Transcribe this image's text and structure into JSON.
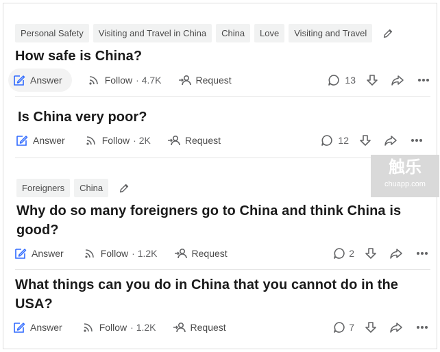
{
  "questions": [
    {
      "topics": [
        "Personal Safety",
        "Visiting and Travel in China",
        "China",
        "Love",
        "Visiting and Travel"
      ],
      "title": "How safe is China?",
      "answer_label": "Answer",
      "follow_label": "Follow",
      "follow_count": "· 4.7K",
      "request_label": "Request",
      "comment_count": "13"
    },
    {
      "topics": [],
      "title": "Is China very poor?",
      "answer_label": "Answer",
      "follow_label": "Follow",
      "follow_count": "· 2K",
      "request_label": "Request",
      "comment_count": "12"
    },
    {
      "topics": [
        "Foreigners",
        "China"
      ],
      "title_line1": "Why do so many foreigners go to China and think China is",
      "title_line2": "good?",
      "answer_label": "Answer",
      "follow_label": "Follow",
      "follow_count": "· 1.2K",
      "request_label": "Request",
      "comment_count": "2"
    },
    {
      "topics": [],
      "title_line1": "What things can you do in China that you cannot do in the",
      "title_line2": "USA?",
      "answer_label": "Answer",
      "follow_label": "Follow",
      "follow_count": "· 1.2K",
      "request_label": "Request",
      "comment_count": "7"
    }
  ],
  "watermark": {
    "line1": "触乐",
    "line2": "chuapp.com"
  },
  "icons": [
    "pencil-icon",
    "answer-icon",
    "follow-icon",
    "request-icon",
    "comment-icon",
    "downvote-icon",
    "share-icon",
    "more-icon"
  ]
}
